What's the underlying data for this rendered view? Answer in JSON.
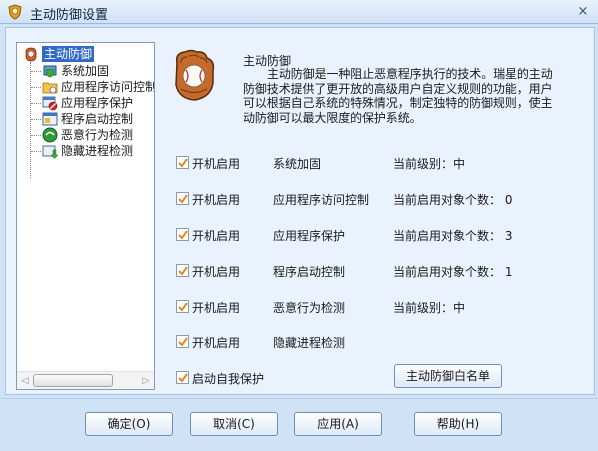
{
  "window": {
    "title": "主动防御设置",
    "close_label": "×"
  },
  "tree": {
    "root": "主动防御",
    "items": [
      {
        "label": "系统加固",
        "icon": "shield-system-icon"
      },
      {
        "label": "应用程序访问控制",
        "icon": "folder-access-icon"
      },
      {
        "label": "应用程序保护",
        "icon": "app-protect-icon"
      },
      {
        "label": "程序启动控制",
        "icon": "program-start-icon"
      },
      {
        "label": "恶意行为检测",
        "icon": "malware-detect-icon"
      },
      {
        "label": "隐藏进程检测",
        "icon": "hidden-process-icon"
      }
    ],
    "scroll_left": "◁",
    "scroll_right": "▷"
  },
  "main": {
    "title": "主动防御",
    "description": "主动防御是一种阻止恶意程序执行的技术。瑞星的主动防御技术提供了更开放的高级用户自定义规则的功能，用户可以根据自己系统的特殊情况，制定独特的防御规则，使主动防御可以最大限度的保护系统。",
    "rows": [
      {
        "checkbox_label": "开机启用",
        "name": "系统加固",
        "status": "当前级别：中",
        "checked": true
      },
      {
        "checkbox_label": "开机启用",
        "name": "应用程序访问控制",
        "status": "当前启用对象个数： 0",
        "checked": true
      },
      {
        "checkbox_label": "开机启用",
        "name": "应用程序保护",
        "status": "当前启用对象个数： 3",
        "checked": true
      },
      {
        "checkbox_label": "开机启用",
        "name": "程序启动控制",
        "status": "当前启用对象个数： 1",
        "checked": true
      },
      {
        "checkbox_label": "开机启用",
        "name": "恶意行为检测",
        "status": "当前级别：中",
        "checked": true
      },
      {
        "checkbox_label": "开机启用",
        "name": "隐藏进程检测",
        "status": "",
        "checked": true
      }
    ],
    "self_protect_label": "启动自我保护",
    "self_protect_checked": true,
    "whitelist_button": "主动防御白名单"
  },
  "buttons": {
    "ok": "确定(O)",
    "cancel": "取消(C)",
    "apply": "应用(A)",
    "help": "帮助(H)"
  },
  "colors": {
    "accent": "#316ac5",
    "window_bg": "#cfe2f6",
    "panel_bg": "#eaf3fd",
    "check": "#e08a1e"
  }
}
